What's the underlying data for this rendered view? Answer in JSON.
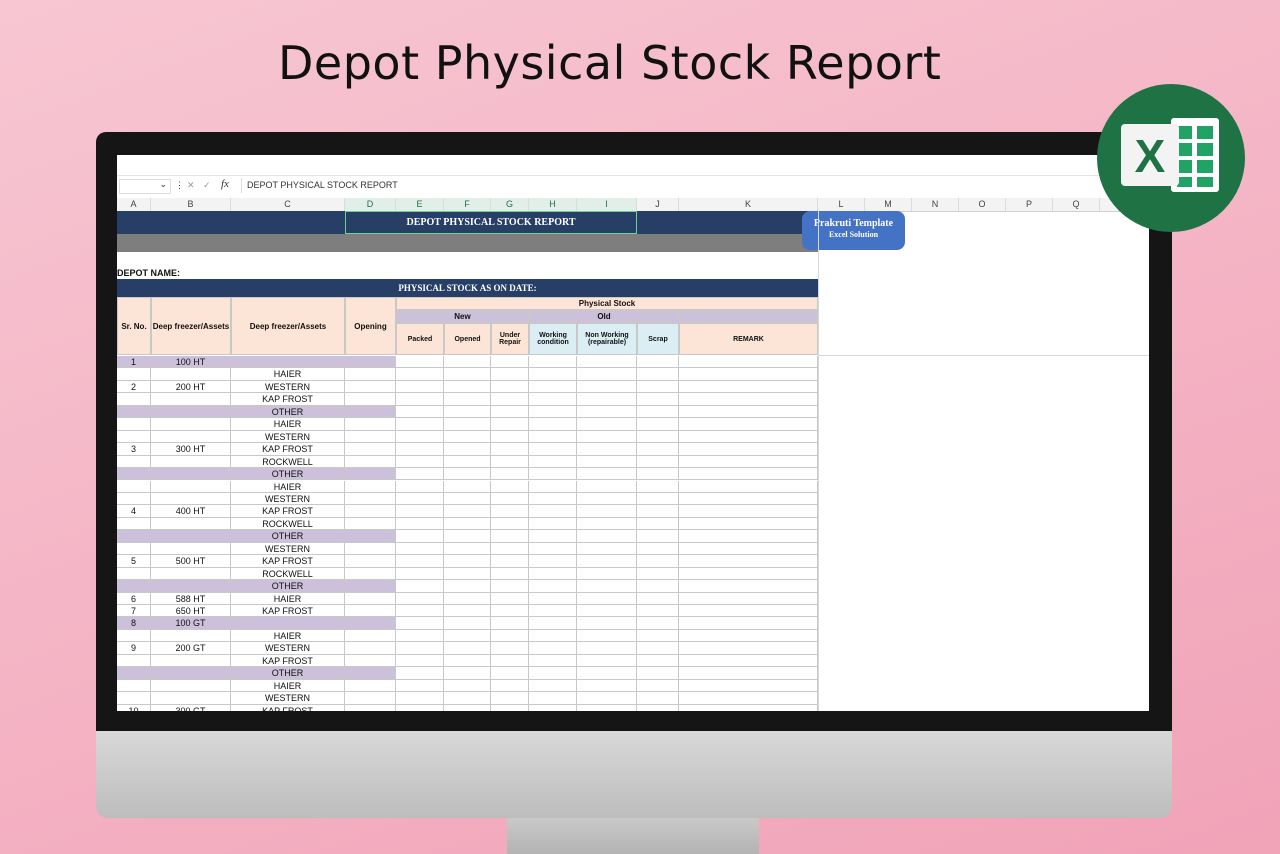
{
  "page": {
    "title": "Depot Physical Stock Report"
  },
  "formula_bar": {
    "name_box": "",
    "fx": "fx",
    "content": "DEPOT PHYSICAL STOCK REPORT"
  },
  "columns": [
    "A",
    "B",
    "C",
    "D",
    "E",
    "F",
    "G",
    "H",
    "I",
    "J",
    "K",
    "L",
    "M",
    "N",
    "O",
    "P",
    "Q"
  ],
  "sheet": {
    "report_title": "DEPOT PHYSICAL STOCK REPORT",
    "depot_name_label": "DEPOT NAME:",
    "stock_date_label": "PHYSICAL STOCK AS ON DATE:",
    "badge": {
      "line1": "Prakruti Template",
      "line2": "Excel Solution"
    },
    "headers": {
      "sr_no": "Sr. No.",
      "assets_b": "Deep freezer/Assets",
      "assets_c": "Deep freezer/Assets",
      "opening": "Opening",
      "physical_stock": "Physical Stock",
      "new": "New",
      "old": "Old",
      "packed": "Packed",
      "opened": "Opened",
      "under_repair": "Under Repair",
      "working": "Working condition",
      "non_working": "Non Working (repairable)",
      "scrap": "Scrap",
      "remark": "REMARK"
    },
    "rows": [
      {
        "sr": "1",
        "b": "100 HT",
        "c": "",
        "lav": true
      },
      {
        "sr": "",
        "b": "",
        "c": "HAIER"
      },
      {
        "sr": "2",
        "b": "200 HT",
        "c": "WESTERN"
      },
      {
        "sr": "",
        "b": "",
        "c": "KAP FROST"
      },
      {
        "sr": "",
        "b": "",
        "c": "OTHER",
        "lav": true
      },
      {
        "sr": "",
        "b": "",
        "c": "HAIER"
      },
      {
        "sr": "",
        "b": "",
        "c": "WESTERN"
      },
      {
        "sr": "3",
        "b": "300 HT",
        "c": "KAP FROST"
      },
      {
        "sr": "",
        "b": "",
        "c": "ROCKWELL"
      },
      {
        "sr": "",
        "b": "",
        "c": "OTHER",
        "lav": true
      },
      {
        "sr": "",
        "b": "",
        "c": "HAIER"
      },
      {
        "sr": "",
        "b": "",
        "c": "WESTERN"
      },
      {
        "sr": "4",
        "b": "400 HT",
        "c": "KAP FROST"
      },
      {
        "sr": "",
        "b": "",
        "c": "ROCKWELL"
      },
      {
        "sr": "",
        "b": "",
        "c": "OTHER",
        "lav": true
      },
      {
        "sr": "",
        "b": "",
        "c": "WESTERN"
      },
      {
        "sr": "5",
        "b": "500 HT",
        "c": "KAP FROST"
      },
      {
        "sr": "",
        "b": "",
        "c": "ROCKWELL"
      },
      {
        "sr": "",
        "b": "",
        "c": "OTHER",
        "lav": true
      },
      {
        "sr": "6",
        "b": "588 HT",
        "c": "HAIER"
      },
      {
        "sr": "7",
        "b": "650 HT",
        "c": "KAP FROST"
      },
      {
        "sr": "8",
        "b": "100 GT",
        "c": "",
        "lav": true
      },
      {
        "sr": "",
        "b": "",
        "c": "HAIER"
      },
      {
        "sr": "9",
        "b": "200 GT",
        "c": "WESTERN"
      },
      {
        "sr": "",
        "b": "",
        "c": "KAP FROST"
      },
      {
        "sr": "",
        "b": "",
        "c": "OTHER",
        "lav": true
      },
      {
        "sr": "",
        "b": "",
        "c": "HAIER"
      },
      {
        "sr": "",
        "b": "",
        "c": "WESTERN"
      },
      {
        "sr": "10",
        "b": "300 GT",
        "c": "KAP FROST"
      }
    ]
  },
  "logo": {
    "letter": "X",
    "name": "excel-logo-icon"
  },
  "colors": {
    "navy_band": "#273f66",
    "grey_band": "#7e7e7e",
    "peach": "#fce4d6",
    "lavender": "#ccc0da",
    "light_blue": "#daeef3",
    "badge": "#4472c4"
  }
}
